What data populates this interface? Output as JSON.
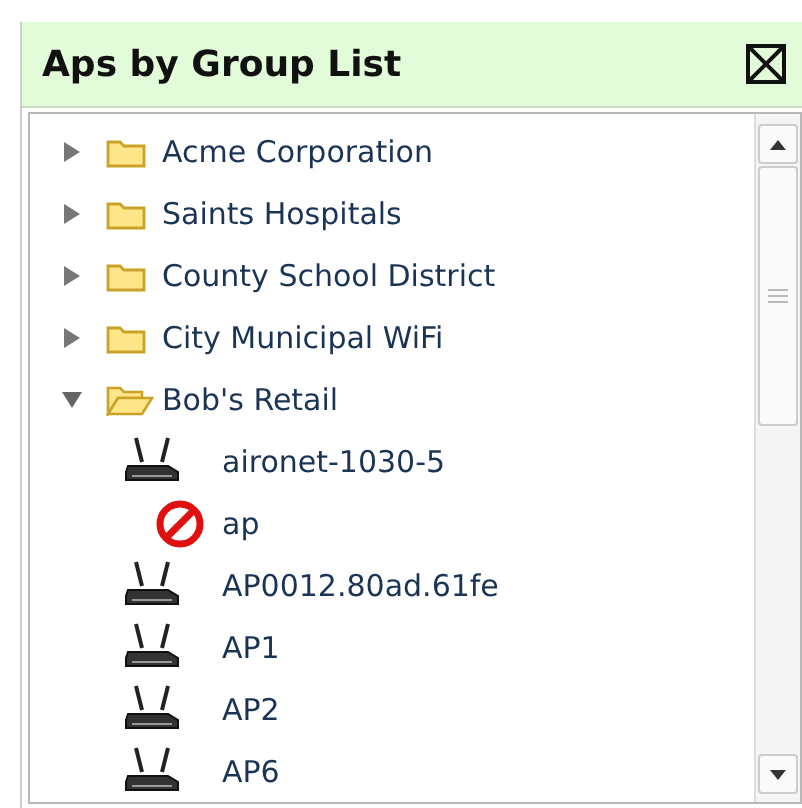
{
  "panel": {
    "title": "Aps by Group List"
  },
  "tree": [
    {
      "label": "Acme Corporation",
      "expanded": false
    },
    {
      "label": "Saints Hospitals",
      "expanded": false
    },
    {
      "label": "County School District",
      "expanded": false
    },
    {
      "label": "City Municipal WiFi",
      "expanded": false
    },
    {
      "label": "Bob's Retail",
      "expanded": true,
      "children": [
        {
          "label": "aironet-1030-5",
          "kind": "ap"
        },
        {
          "label": "ap",
          "kind": "blocked"
        },
        {
          "label": "AP0012.80ad.61fe",
          "kind": "ap"
        },
        {
          "label": "AP1",
          "kind": "ap"
        },
        {
          "label": "AP2",
          "kind": "ap"
        },
        {
          "label": "AP6",
          "kind": "ap"
        }
      ]
    }
  ]
}
